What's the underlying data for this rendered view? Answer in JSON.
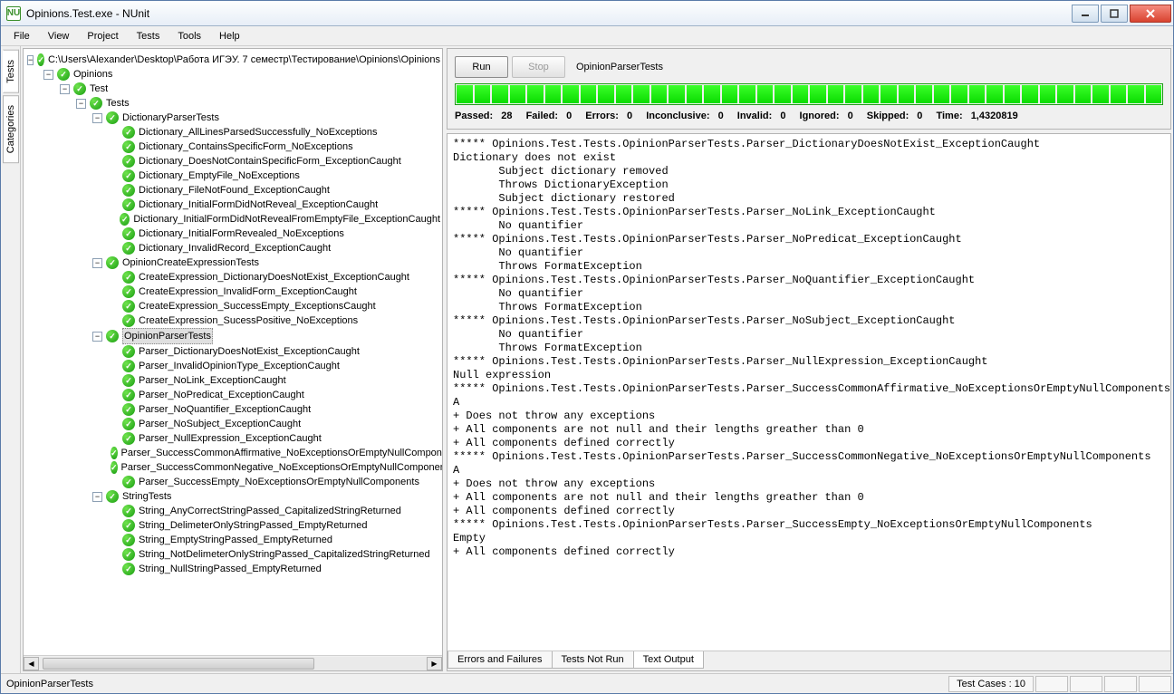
{
  "window": {
    "icon_text": "NU",
    "title": "Opinions.Test.exe - NUnit"
  },
  "menu": [
    "File",
    "View",
    "Project",
    "Tests",
    "Tools",
    "Help"
  ],
  "sidetabs": [
    "Tests",
    "Categories"
  ],
  "toolbar": {
    "run": "Run",
    "stop": "Stop",
    "current_test": "OpinionParserTests"
  },
  "summary": {
    "passed_label": "Passed:",
    "passed": "28",
    "failed_label": "Failed:",
    "failed": "0",
    "errors_label": "Errors:",
    "errors": "0",
    "inconclusive_label": "Inconclusive:",
    "inconclusive": "0",
    "invalid_label": "Invalid:",
    "invalid": "0",
    "ignored_label": "Ignored:",
    "ignored": "0",
    "skipped_label": "Skipped:",
    "skipped": "0",
    "time_label": "Time:",
    "time": "1,4320819"
  },
  "tree": {
    "root": "C:\\Users\\Alexander\\Desktop\\Работа ИГЭУ. 7 семестр\\Тестирование\\Opinions\\Opinions",
    "l1": "Opinions",
    "l2": "Test",
    "l3": "Tests",
    "groups": [
      {
        "name": "DictionaryParserTests",
        "tests": [
          "Dictionary_AllLinesParsedSuccessfully_NoExceptions",
          "Dictionary_ContainsSpecificForm_NoExceptions",
          "Dictionary_DoesNotContainSpecificForm_ExceptionCaught",
          "Dictionary_EmptyFile_NoExceptions",
          "Dictionary_FileNotFound_ExceptionCaught",
          "Dictionary_InitialFormDidNotReveal_ExceptionCaught",
          "Dictionary_InitialFormDidNotRevealFromEmptyFile_ExceptionCaught",
          "Dictionary_InitialFormRevealed_NoExceptions",
          "Dictionary_InvalidRecord_ExceptionCaught"
        ]
      },
      {
        "name": "OpinionCreateExpressionTests",
        "tests": [
          "CreateExpression_DictionaryDoesNotExist_ExceptionCaught",
          "CreateExpression_InvalidForm_ExceptionCaught",
          "CreateExpression_SuccessEmpty_ExceptionsCaught",
          "CreateExpression_SucessPositive_NoExceptions"
        ]
      },
      {
        "name": "OpinionParserTests",
        "selected": true,
        "tests": [
          "Parser_DictionaryDoesNotExist_ExceptionCaught",
          "Parser_InvalidOpinionType_ExceptionCaught",
          "Parser_NoLink_ExceptionCaught",
          "Parser_NoPredicat_ExceptionCaught",
          "Parser_NoQuantifier_ExceptionCaught",
          "Parser_NoSubject_ExceptionCaught",
          "Parser_NullExpression_ExceptionCaught",
          "Parser_SuccessCommonAffirmative_NoExceptionsOrEmptyNullComponents",
          "Parser_SuccessCommonNegative_NoExceptionsOrEmptyNullComponents",
          "Parser_SuccessEmpty_NoExceptionsOrEmptyNullComponents"
        ]
      },
      {
        "name": "StringTests",
        "tests": [
          "String_AnyCorrectStringPassed_CapitalizedStringReturned",
          "String_DelimeterOnlyStringPassed_EmptyReturned",
          "String_EmptyStringPassed_EmptyReturned",
          "String_NotDelimeterOnlyStringPassed_CapitalizedStringReturned",
          "String_NullStringPassed_EmptyReturned"
        ]
      }
    ]
  },
  "output_tabs": [
    "Errors and Failures",
    "Tests Not Run",
    "Text Output"
  ],
  "output_text": "***** Opinions.Test.Tests.OpinionParserTests.Parser_DictionaryDoesNotExist_ExceptionCaught\nDictionary does not exist\n       Subject dictionary removed\n       Throws DictionaryException\n       Subject dictionary restored\n***** Opinions.Test.Tests.OpinionParserTests.Parser_NoLink_ExceptionCaught\n       No quantifier\n***** Opinions.Test.Tests.OpinionParserTests.Parser_NoPredicat_ExceptionCaught\n       No quantifier\n       Throws FormatException\n***** Opinions.Test.Tests.OpinionParserTests.Parser_NoQuantifier_ExceptionCaught\n       No quantifier\n       Throws FormatException\n***** Opinions.Test.Tests.OpinionParserTests.Parser_NoSubject_ExceptionCaught\n       No quantifier\n       Throws FormatException\n***** Opinions.Test.Tests.OpinionParserTests.Parser_NullExpression_ExceptionCaught\nNull expression\n***** Opinions.Test.Tests.OpinionParserTests.Parser_SuccessCommonAffirmative_NoExceptionsOrEmptyNullComponents\nA\n+ Does not throw any exceptions\n+ All components are not null and their lengths greather than 0\n+ All components defined correctly\n***** Opinions.Test.Tests.OpinionParserTests.Parser_SuccessCommonNegative_NoExceptionsOrEmptyNullComponents\nA\n+ Does not throw any exceptions\n+ All components are not null and their lengths greather than 0\n+ All components defined correctly\n***** Opinions.Test.Tests.OpinionParserTests.Parser_SuccessEmpty_NoExceptionsOrEmptyNullComponents\nEmpty\n+ All components defined correctly",
  "statusbar": {
    "left": "OpinionParserTests",
    "testcases": "Test Cases : 10"
  }
}
